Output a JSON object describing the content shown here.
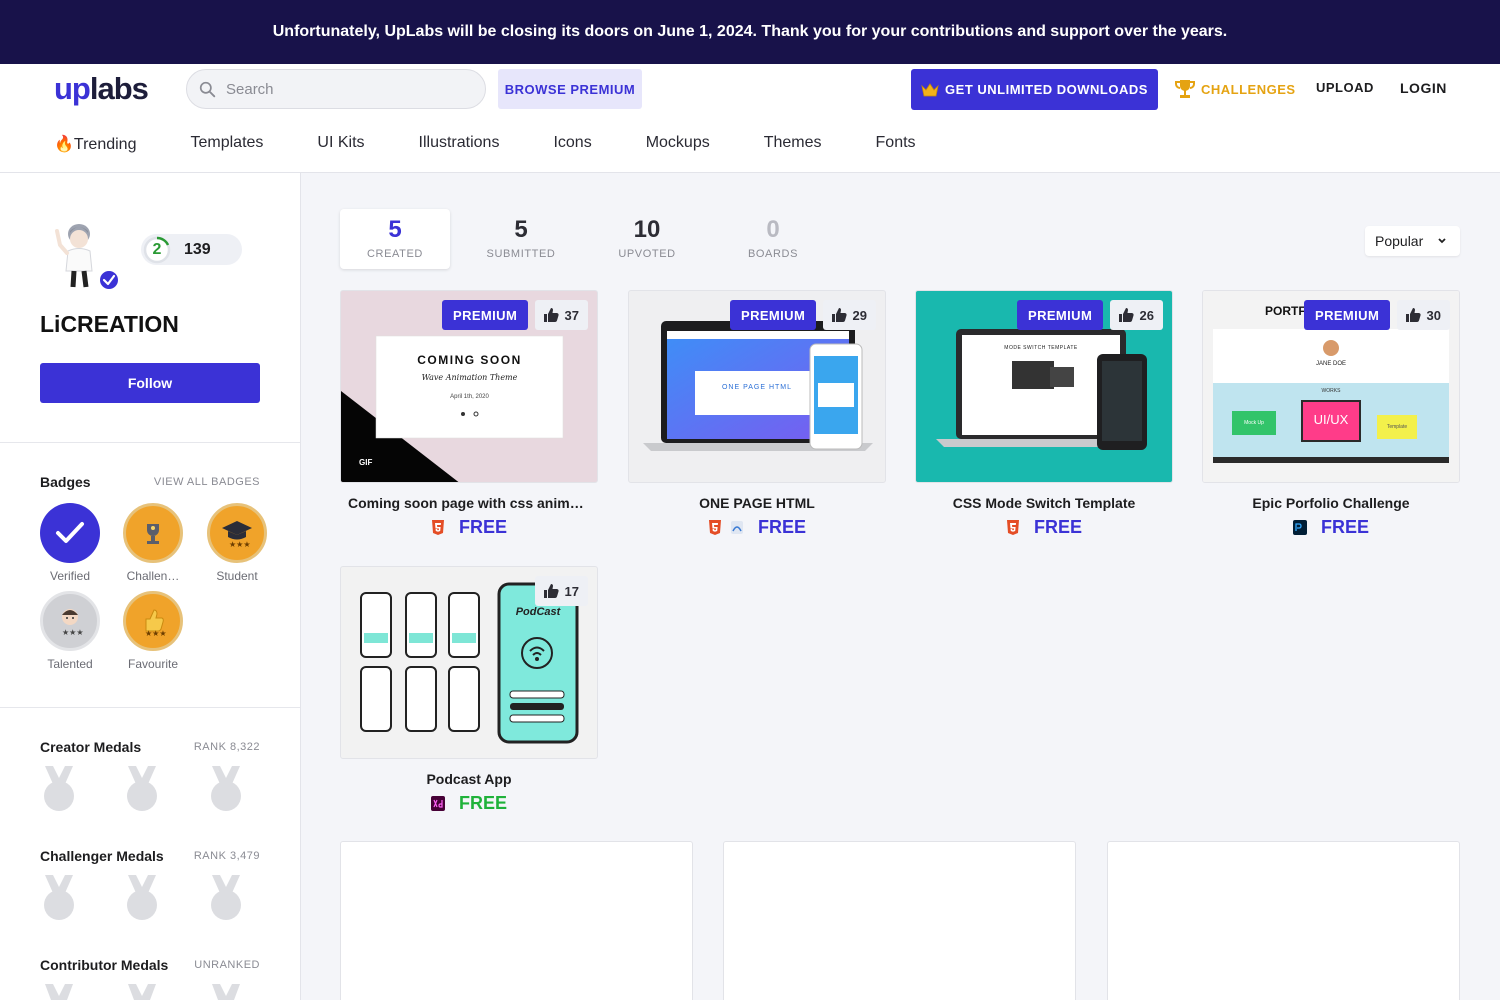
{
  "banner": {
    "text": "Unfortunately, UpLabs will be closing its doors on June 1, 2024. Thank you for your contributions and support over the years."
  },
  "header": {
    "logo_up": "up",
    "logo_labs": "labs",
    "search_placeholder": "Search",
    "browse_premium": "BROWSE PREMIUM",
    "unlimited": "GET UNLIMITED DOWNLOADS",
    "challenges": "CHALLENGES",
    "upload": "UPLOAD",
    "login": "LOGIN",
    "categories": [
      "🔥Trending",
      "Templates",
      "UI Kits",
      "Illustrations",
      "Icons",
      "Mockups",
      "Themes",
      "Fonts"
    ]
  },
  "profile": {
    "level": "2",
    "points": "139",
    "name": "LiCREATION",
    "follow": "Follow"
  },
  "badges": {
    "title": "Badges",
    "view_all": "VIEW ALL BADGES",
    "items": [
      {
        "label": "Verified",
        "icon": "check-icon",
        "color": "#3b32d6"
      },
      {
        "label": "Challen…",
        "icon": "trophy-icon",
        "color": "#f0a32a"
      },
      {
        "label": "Student",
        "icon": "graduation-cap-icon",
        "color": "#f0a32a"
      },
      {
        "label": "Talented",
        "icon": "person-icon",
        "color": "#cfd0d4"
      },
      {
        "label": "Favourite",
        "icon": "thumbs-up-icon",
        "color": "#f0a32a"
      }
    ]
  },
  "medals": [
    {
      "title": "Creator Medals",
      "rank": "RANK 8,322"
    },
    {
      "title": "Challenger Medals",
      "rank": "RANK 3,479"
    },
    {
      "title": "Contributor Medals",
      "rank": "UNRANKED"
    }
  ],
  "tabs": [
    {
      "count": "5",
      "label": "CREATED"
    },
    {
      "count": "5",
      "label": "SUBMITTED"
    },
    {
      "count": "10",
      "label": "UPVOTED"
    },
    {
      "count": "0",
      "label": "BOARDS"
    }
  ],
  "sort": "Popular",
  "cards": [
    {
      "title": "Coming soon page with css animati…",
      "likes": "37",
      "premium": "PREMIUM",
      "price": "FREE",
      "thumb_title": "COMING SOON",
      "thumb_sub": "Wave Animation Theme",
      "thumb_date": "April 1th, 2020",
      "thumb_tag": "GIF"
    },
    {
      "title": "ONE PAGE HTML",
      "likes": "29",
      "premium": "PREMIUM",
      "price": "FREE",
      "thumb_title": "ONE PAGE HTML"
    },
    {
      "title": "CSS Mode Switch Template",
      "likes": "26",
      "premium": "PREMIUM",
      "price": "FREE",
      "thumb_title": "MODE SWITCH TEMPLATE"
    },
    {
      "title": "Epic Porfolio Challenge",
      "likes": "30",
      "premium": "PREMIUM",
      "price": "FREE",
      "thumb_title": "PORTF",
      "thumb_name": "JANE DOE",
      "thumb_works": "WORKS",
      "thumb_uiux": "UI/UX",
      "thumb_mockup": "Mock Up",
      "thumb_template": "Template"
    },
    {
      "title": "Podcast App",
      "likes": "17",
      "price": "FREE",
      "thumb_title": "PodCast"
    }
  ]
}
